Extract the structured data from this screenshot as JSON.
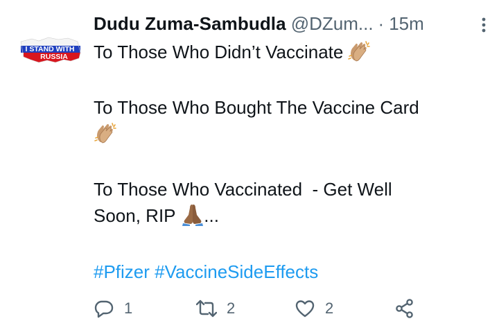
{
  "tweet": {
    "avatar_text_top": "I STAND WITH",
    "avatar_text_bottom": "RUSSIA",
    "display_name": "Dudu Zuma-Sambudla",
    "handle": "@DZum...",
    "separator": "·",
    "time": "15m",
    "lines": {
      "line1": "To Those Who Didn’t Vaccinate",
      "line2": "To Those Who Bought The Vaccine Card",
      "line3a": "To Those Who Vaccinated  - Get Well",
      "line3b": "Soon, RIP",
      "ellipsis": "..."
    },
    "hashtags": {
      "tag1": "#Pfizer",
      "tag2": "#VaccineSideEffects"
    },
    "actions": {
      "replies": "1",
      "retweets": "2",
      "likes": "2"
    },
    "colors": {
      "hashtag": "#1d9bf0",
      "secondary_text": "#536471",
      "primary_text": "#0f1419"
    },
    "icons": [
      "more-icon",
      "reply-icon",
      "retweet-icon",
      "like-icon",
      "share-icon",
      "clapping-hands-emoji",
      "folded-hands-emoji"
    ]
  }
}
